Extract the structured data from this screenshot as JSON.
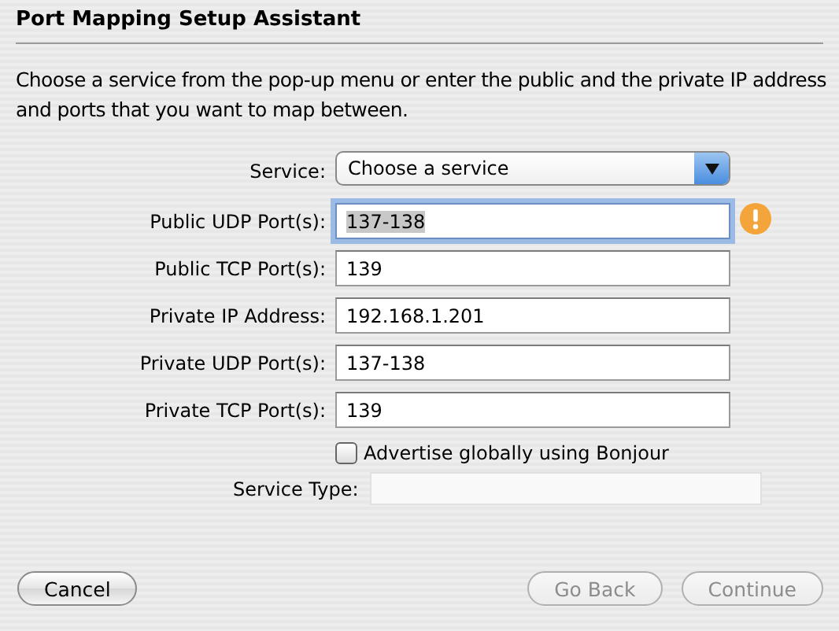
{
  "window": {
    "title": "Port Mapping Setup Assistant"
  },
  "instructions": "Choose a service from the pop-up menu or enter the public and the private IP address and ports that you want to map between.",
  "service": {
    "label": "Service:",
    "value": "Choose a service"
  },
  "fields": [
    {
      "label": "Public UDP Port(s):",
      "value": "137-138",
      "focused": true,
      "warning": true
    },
    {
      "label": "Public TCP Port(s):",
      "value": "139",
      "focused": false,
      "warning": false
    },
    {
      "label": "Private IP Address:",
      "value": "192.168.1.201",
      "focused": false,
      "warning": false
    },
    {
      "label": "Private UDP Port(s):",
      "value": "137-138",
      "focused": false,
      "warning": false
    },
    {
      "label": "Private TCP Port(s):",
      "value": "139",
      "focused": false,
      "warning": false
    }
  ],
  "bonjour": {
    "label": "Advertise globally using Bonjour",
    "checked": false
  },
  "service_type": {
    "label": "Service Type:",
    "disabled": true
  },
  "buttons": [
    {
      "label": "Cancel",
      "disabled": false
    },
    {
      "label": "Go Back",
      "disabled": true
    },
    {
      "label": "Continue",
      "disabled": true
    }
  ]
}
